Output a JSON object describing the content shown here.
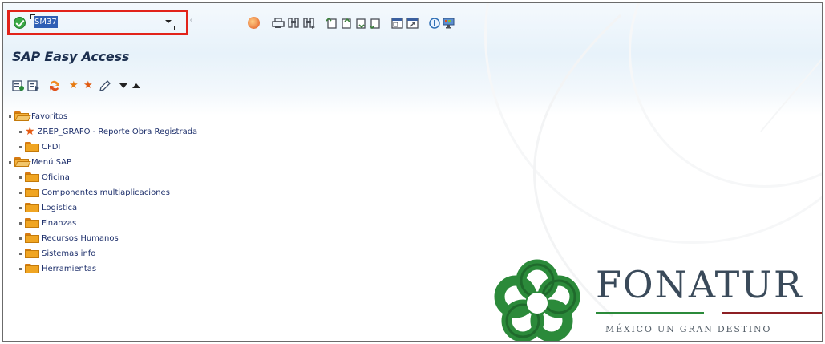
{
  "command_field": {
    "value": "SM37"
  },
  "toolbar": {
    "back_glyph": "‹",
    "icons": [
      "ok-icon",
      "cancel-icon",
      "print-icon",
      "find-icon",
      "find-next-icon",
      "first-page-icon",
      "prev-page-icon",
      "next-page-icon",
      "last-page-icon",
      "create-session-icon",
      "shortcut-icon",
      "help-icon",
      "customize-layout-icon"
    ]
  },
  "page": {
    "title": "SAP Easy Access"
  },
  "app_toolbar": {
    "icons": [
      "user-menu-icon",
      "sap-menu-icon",
      "other-menu-icon",
      "add-favorite-icon",
      "delete-favorite-icon",
      "change-favorite-icon",
      "expand-arrow-icon",
      "collapse-arrow-icon"
    ]
  },
  "tree": {
    "favorites": {
      "label": "Favoritos",
      "items": [
        {
          "label": "ZREP_GRAFO - Reporte Obra Registrada",
          "icon": "star-icon"
        },
        {
          "label": "CFDI",
          "icon": "folder-icon"
        }
      ]
    },
    "sap_menu": {
      "label": "Menú SAP",
      "items": [
        {
          "label": "Oficina"
        },
        {
          "label": "Componentes multiaplicaciones"
        },
        {
          "label": "Logística"
        },
        {
          "label": "Finanzas"
        },
        {
          "label": "Recursos Humanos"
        },
        {
          "label": "Sistemas info"
        },
        {
          "label": "Herramientas"
        }
      ]
    }
  },
  "logo": {
    "name": "FONATUR",
    "tagline": "MÉXICO UN GRAN DESTINO"
  },
  "colors": {
    "highlight_border": "#e2231a",
    "selection": "#2f5fb5",
    "folder": "#f0a522",
    "logo_green": "#2b8a3a",
    "logo_red": "#8d1f24"
  }
}
